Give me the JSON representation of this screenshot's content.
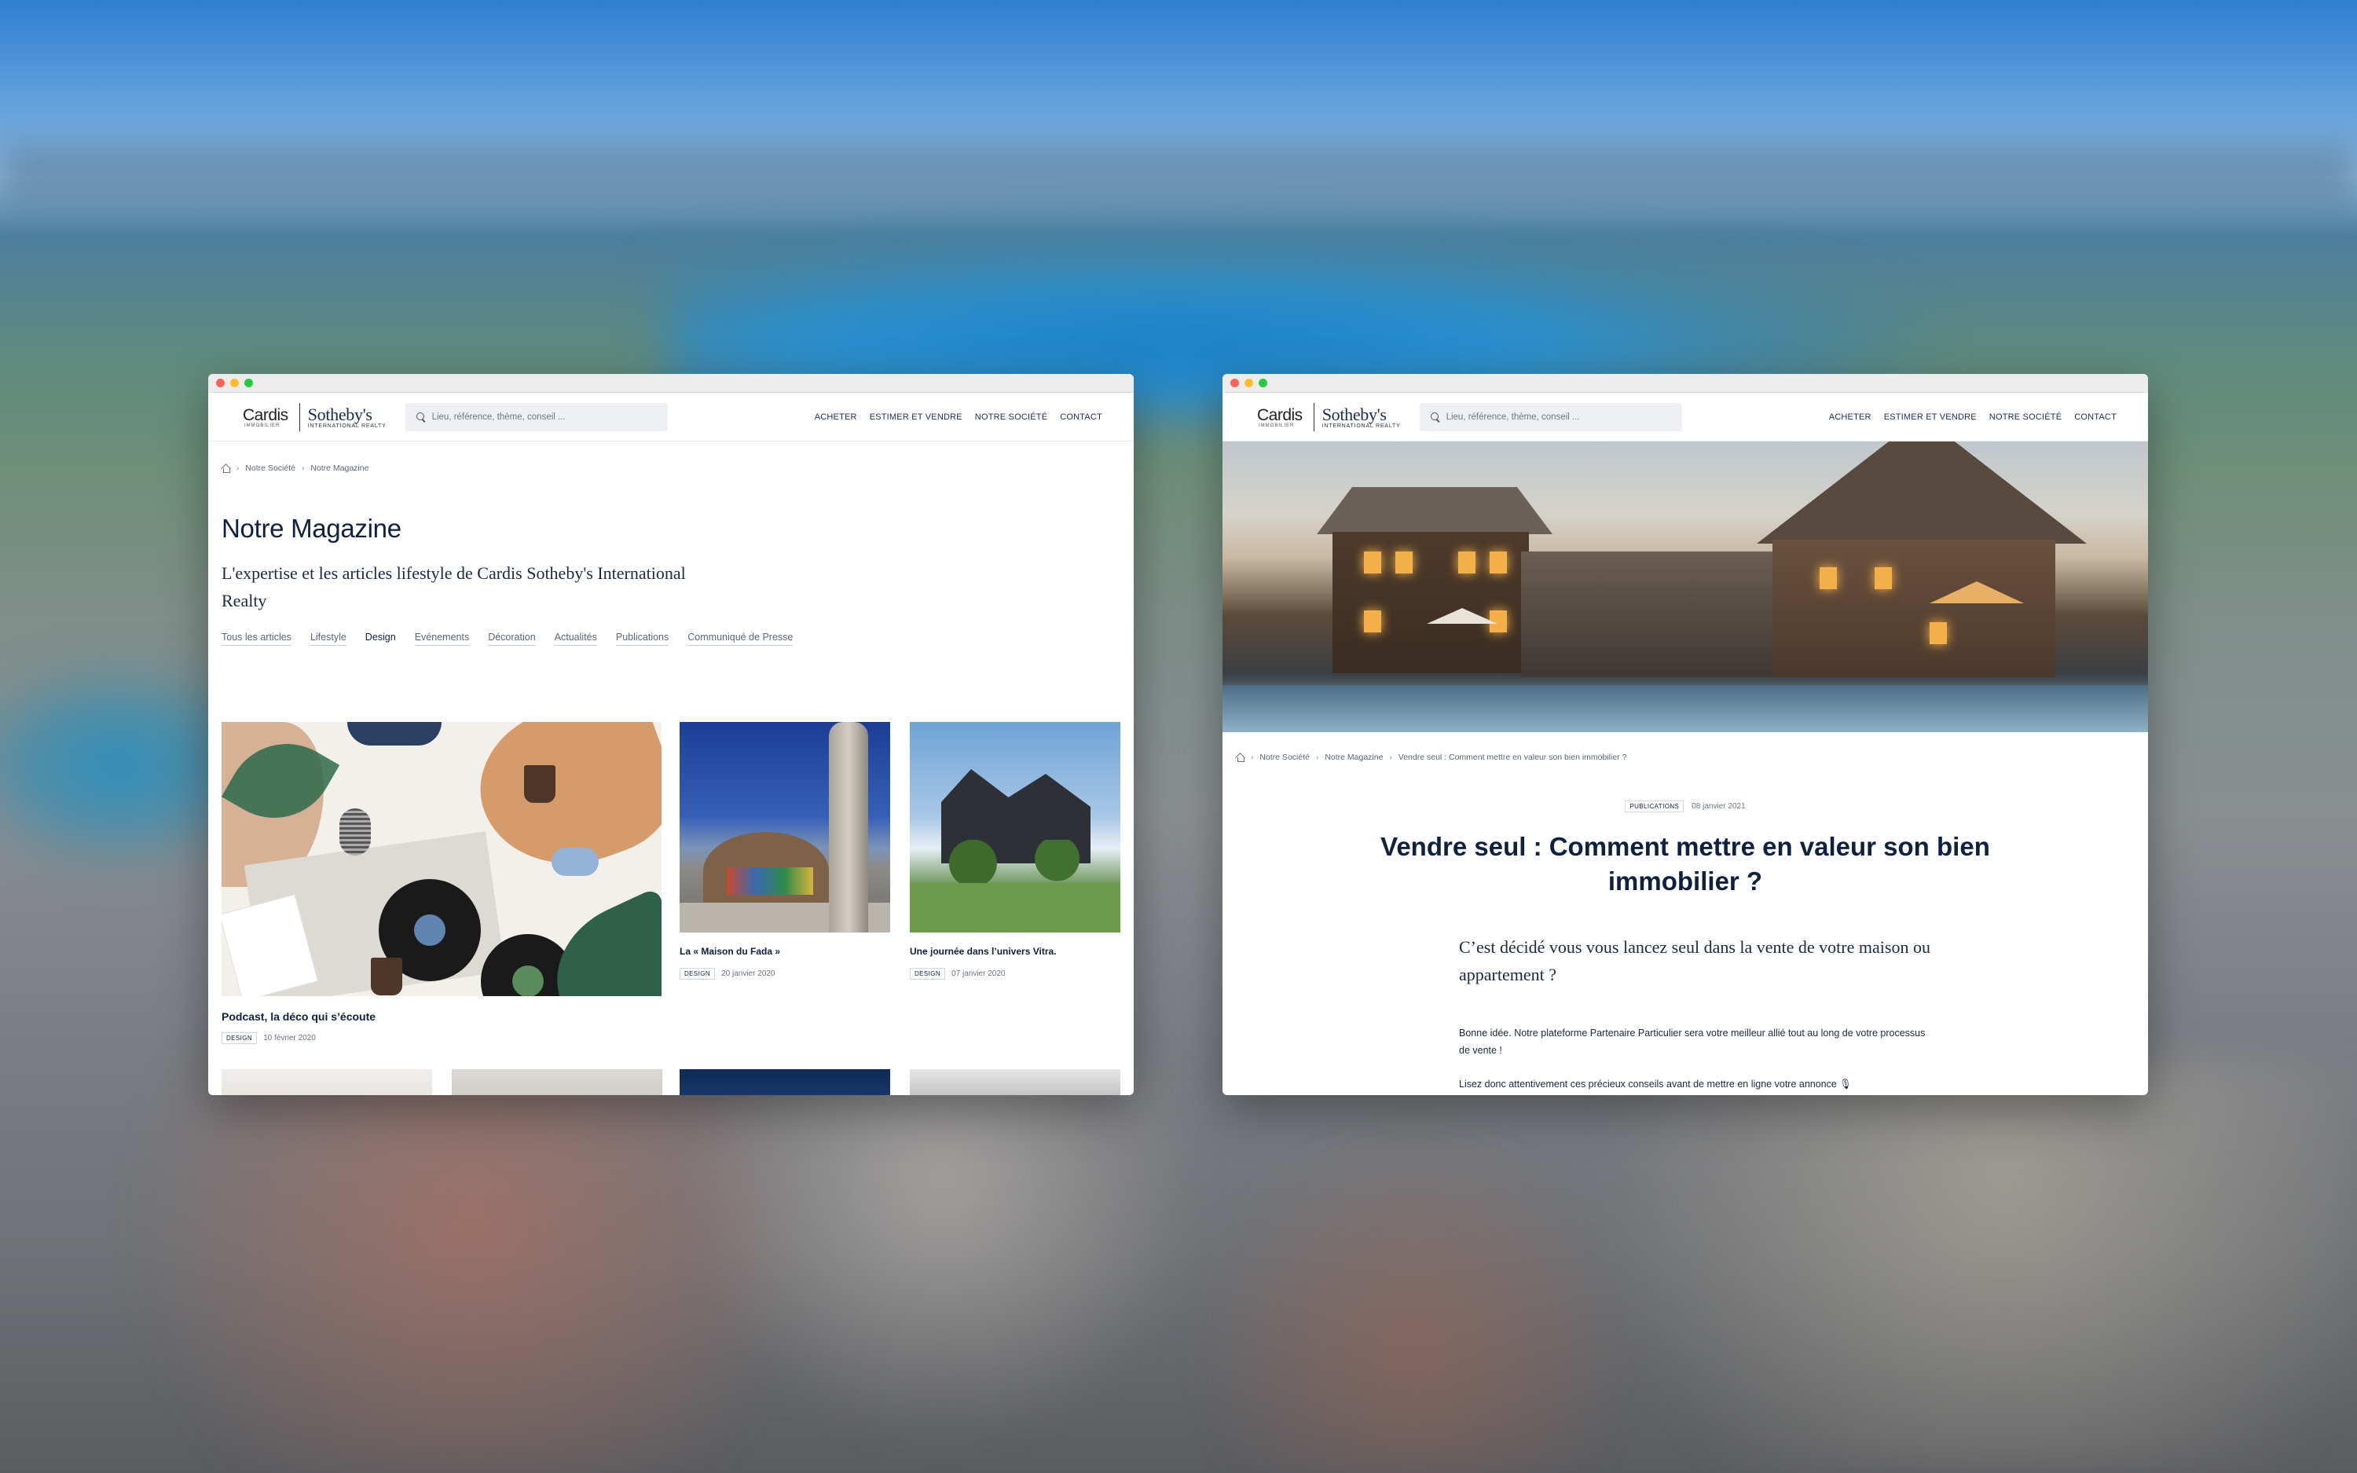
{
  "header": {
    "logo_cardis": "Cardis",
    "logo_cardis_sub": "IMMOBILIER",
    "logo_sothebys": "Sotheby's",
    "logo_sothebys_sub": "INTERNATIONAL REALTY",
    "search_placeholder": "Lieu, référence, thème, conseil ...",
    "nav": [
      "ACHETER",
      "ESTIMER ET VENDRE",
      "NOTRE SOCIÉTÉ",
      "CONTACT"
    ]
  },
  "magazine": {
    "breadcrumb": [
      "Notre Société",
      "Notre Magazine"
    ],
    "title": "Notre Magazine",
    "subtitle": "L'expertise et les articles lifestyle de Cardis Sotheby's International Realty",
    "filters": [
      "Tous les articles",
      "Lifestyle",
      "Design",
      "Evénements",
      "Décoration",
      "Actualités",
      "Publications",
      "Communiqué de Presse"
    ],
    "active_filter": "Design",
    "cards": [
      {
        "title": "Podcast, la déco qui s’écoute",
        "tag": "DESIGN",
        "date": "10 février 2020"
      },
      {
        "title": "La « Maison du Fada »",
        "tag": "DESIGN",
        "date": "20 janvier 2020"
      },
      {
        "title": "Une journée dans l’univers Vitra.",
        "tag": "DESIGN",
        "date": "07 janvier 2020"
      }
    ]
  },
  "article": {
    "breadcrumb": [
      "Notre Société",
      "Notre Magazine",
      "Vendre seul : Comment mettre en valeur son bien immobilier ?"
    ],
    "tag": "PUBLICATIONS",
    "date": "08 janvier 2021",
    "title": "Vendre seul : Comment mettre en valeur son bien immobilier ?",
    "lead": "C’est décidé vous vous lancez seul dans la vente de votre maison ou appartement ?",
    "paragraph_1": "Bonne idée. Notre plateforme Partenaire Particulier sera votre meilleur allié tout au long de votre processus de vente !",
    "paragraph_2": "Lisez donc attentivement ces précieux conseils avant de mettre en ligne votre annonce 🎙"
  }
}
